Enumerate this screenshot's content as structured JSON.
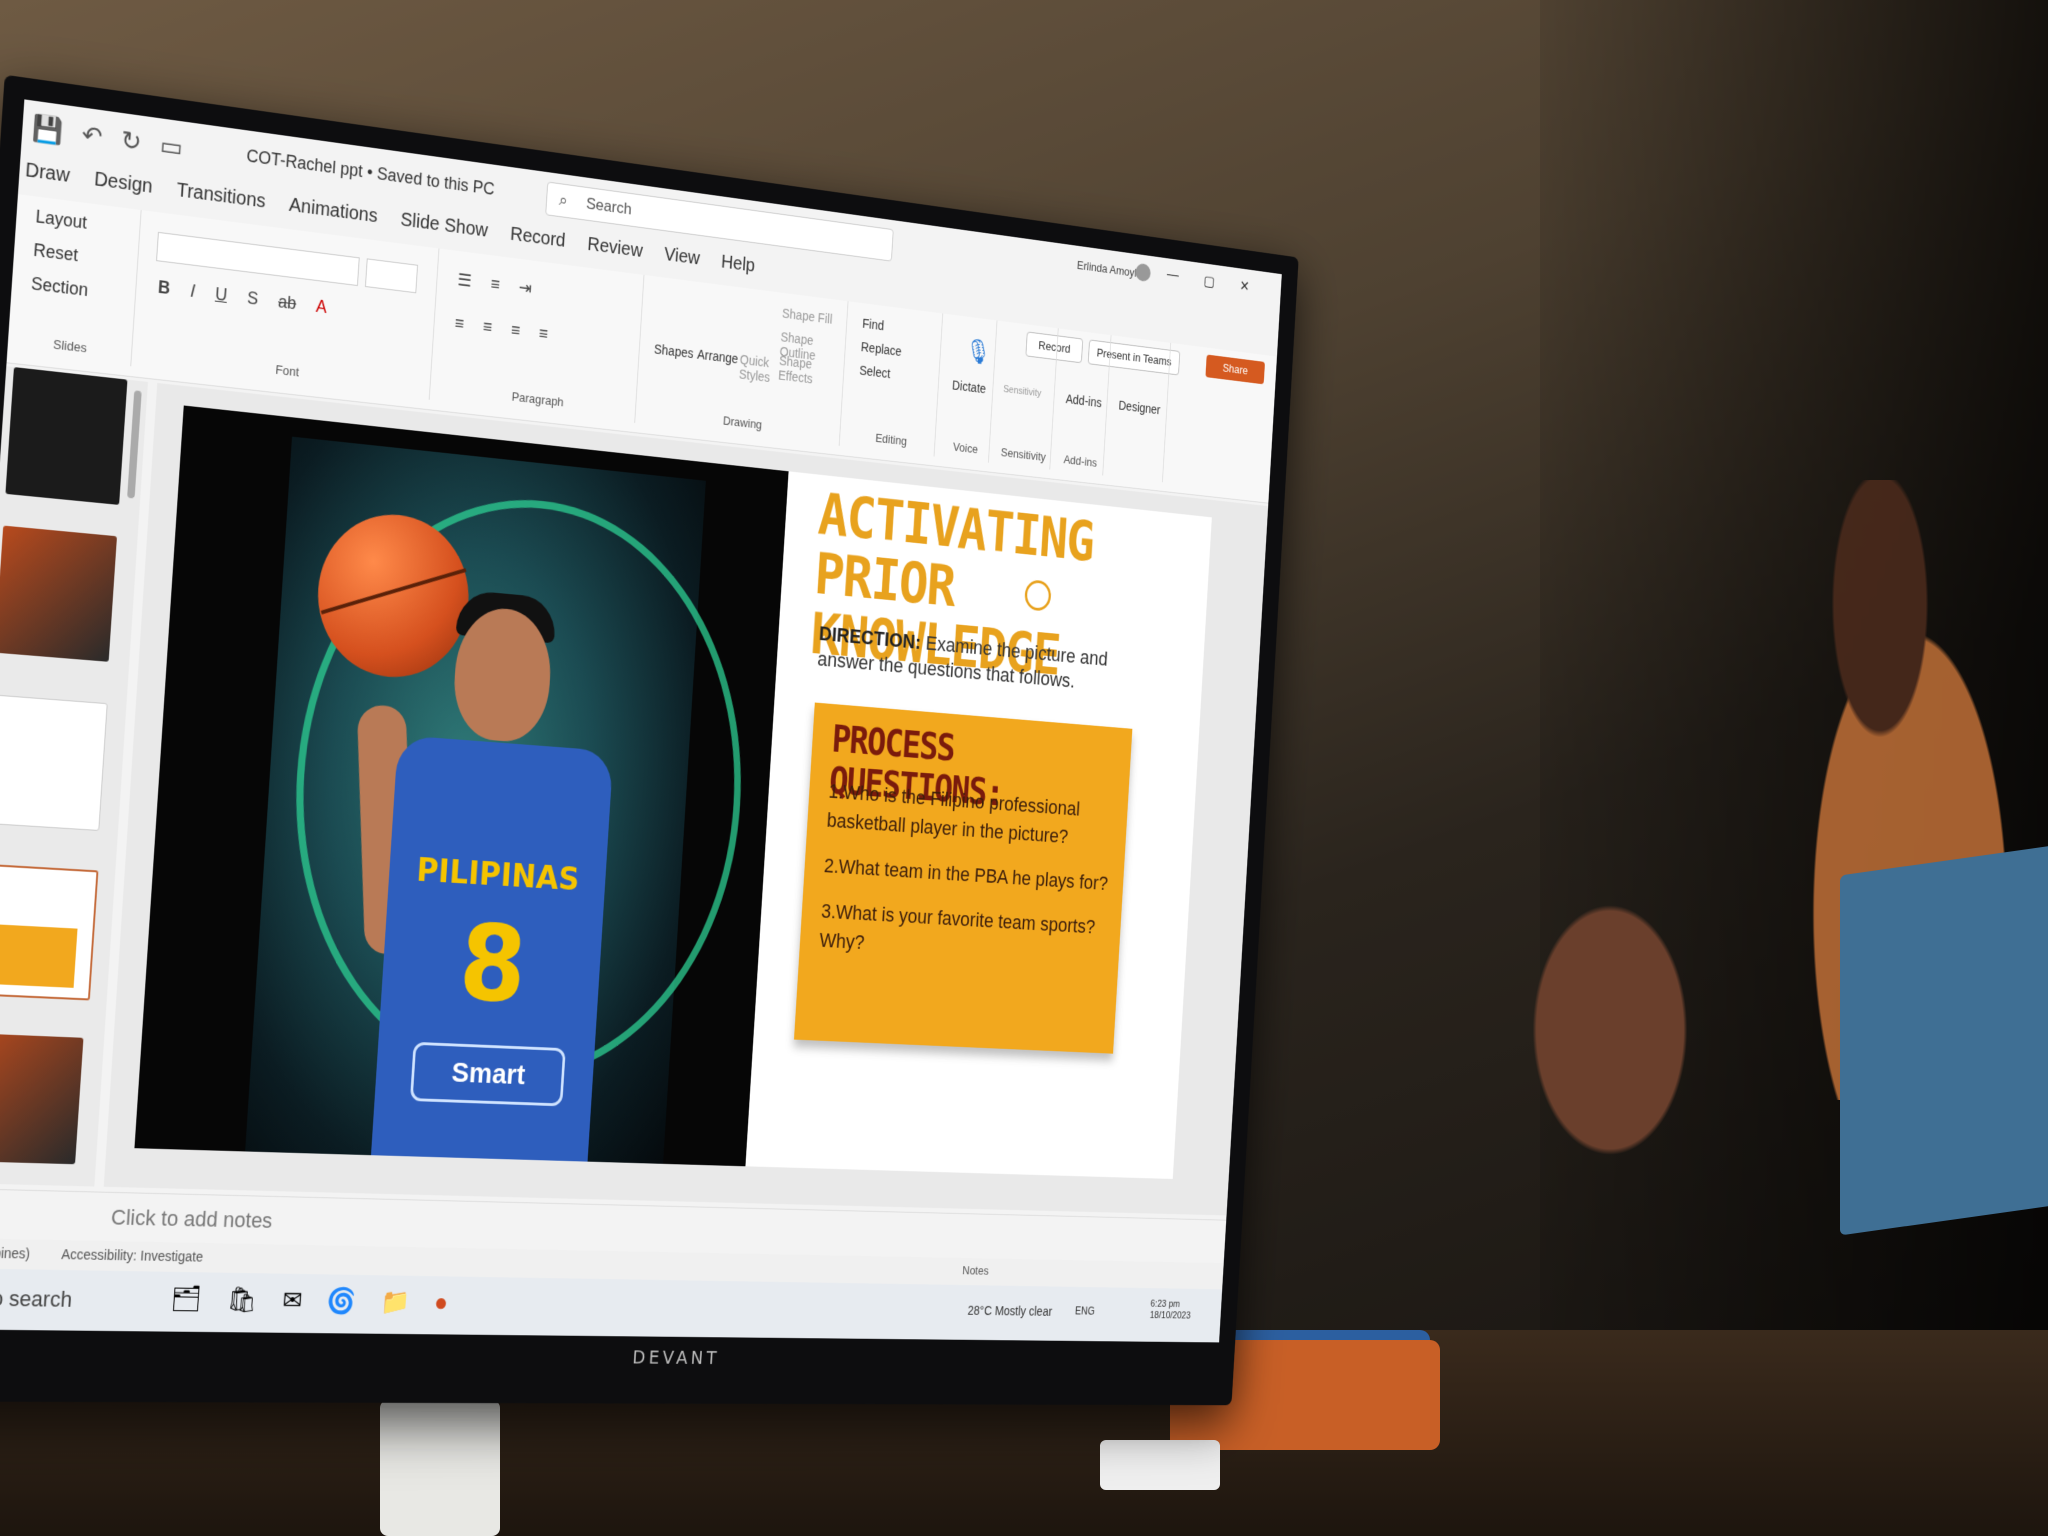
{
  "window": {
    "doc_title": "COT-Rachel ppt • Saved to this PC",
    "search_placeholder": "Search",
    "user_name": "Erlinda Amoylin"
  },
  "tabs": [
    "Draw",
    "Design",
    "Transitions",
    "Animations",
    "Slide Show",
    "Record",
    "Review",
    "View",
    "Help"
  ],
  "ribbon": {
    "slides": {
      "layout": "Layout",
      "reset": "Reset",
      "section": "Section",
      "label": "Slides"
    },
    "font": {
      "label": "Font"
    },
    "paragraph": {
      "label": "Paragraph"
    },
    "drawing": {
      "shapes": "Shapes",
      "arrange": "Arrange",
      "quick_styles": "Quick Styles",
      "shape_fill": "Shape Fill",
      "shape_outline": "Shape Outline",
      "shape_effects": "Shape Effects",
      "label": "Drawing"
    },
    "editing": {
      "find": "Find",
      "replace": "Replace",
      "select": "Select",
      "label": "Editing"
    },
    "voice": {
      "dictate": "Dictate",
      "label": "Voice"
    },
    "sensitivity": {
      "button": "Sensitivity",
      "label": "Sensitivity"
    },
    "addins": {
      "button": "Add-ins",
      "label": "Add-ins"
    },
    "designer": {
      "button": "Designer"
    },
    "record_btn": "Record",
    "teams_btn": "Present in Teams",
    "share_btn": "Share"
  },
  "slide": {
    "heading_line1": "ACTIVATING PRIOR",
    "heading_line2": "KNOWLEDGE",
    "direction_label": "DIRECTION:",
    "direction_text": "Examine the picture and answer the questions that follows.",
    "pq_title": "PROCESS QUESTIONS:",
    "questions": [
      "1.Who is the Filipino professional basketball player in the picture?",
      "2.What team in the PBA he plays for?",
      "3.What is your favorite team sports? Why?"
    ],
    "jersey_name": "PILIPINAS",
    "jersey_number": "8",
    "jersey_sponsor": "Smart"
  },
  "notes_placeholder": "Click to add notes",
  "status": {
    "language": "(Philippines)",
    "accessibility": "Accessibility: Investigate",
    "notes": "Notes"
  },
  "taskbar": {
    "search": "ere to search",
    "weather": "28°C Mostly clear",
    "lang": "ENG",
    "time": "6:23 pm",
    "date": "18/10/2023"
  },
  "monitor_brand": "DEVANT"
}
